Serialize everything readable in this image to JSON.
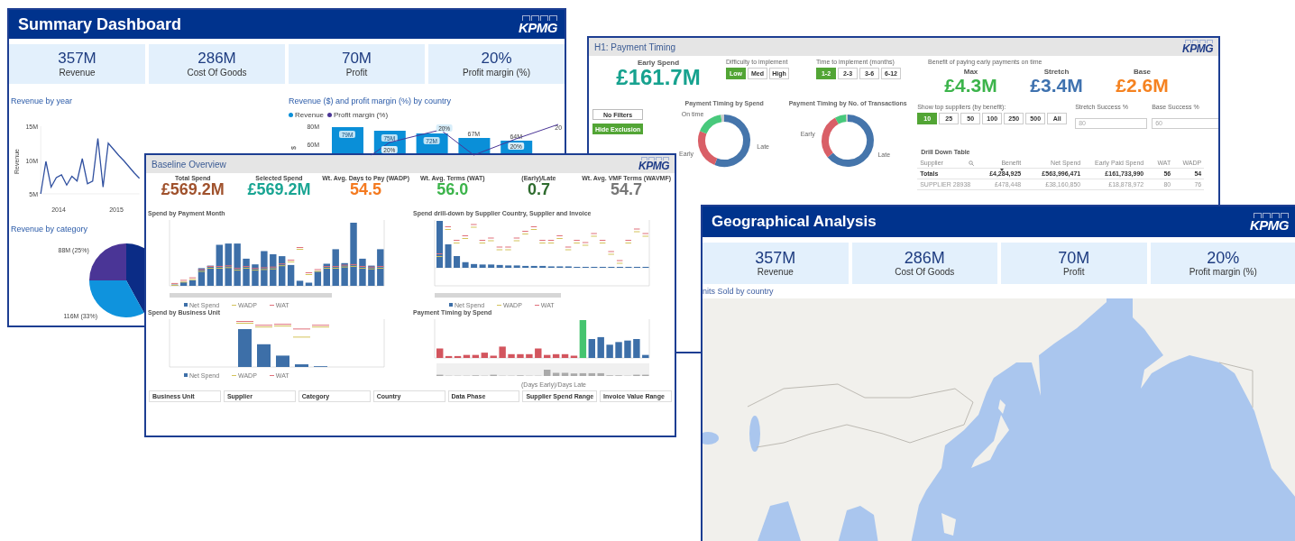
{
  "summary_dashboard": {
    "title": "Summary Dashboard",
    "logo": "KPMG",
    "kpis": [
      {
        "value": "357M",
        "label": "Revenue"
      },
      {
        "value": "286M",
        "label": "Cost Of Goods"
      },
      {
        "value": "70M",
        "label": "Profit"
      },
      {
        "value": "20%",
        "label": "Profit margin (%)"
      }
    ],
    "revenue_by_year": {
      "title": "Revenue by year",
      "chart_data": {
        "type": "line",
        "ylabel": "Revenue",
        "x": [
          2013.69,
          2013.78,
          2013.87,
          2013.96,
          2014.05,
          2014.14,
          2014.23,
          2014.32,
          2014.41,
          2014.5,
          2014.59,
          2014.68,
          2014.77,
          2014.86,
          2014.95,
          2015.04,
          2015.13,
          2015.22,
          2015.31,
          2015.4
        ],
        "xlim": [
          2013.69,
          2015.4
        ],
        "ylim": [
          5,
          15
        ],
        "xticks": [
          2014,
          2015
        ],
        "yticks": [
          {
            "value": 5,
            "label": "5M"
          },
          {
            "value": 10,
            "label": "10M"
          },
          {
            "value": 15,
            "label": "15M"
          }
        ],
        "series": [
          {
            "color": "#2f4f9f",
            "values": [
              5,
              9.8,
              6,
              7.4,
              7.8,
              6.3,
              7.6,
              6.9,
              10.2,
              6.5,
              6.9,
              13.2,
              6,
              12.5,
              11.6,
              10.7,
              9.9,
              9,
              8.1,
              7.3
            ]
          }
        ]
      }
    },
    "revenue_by_country": {
      "title": "Revenue ($) and profit margin (%) by country",
      "chart_data": {
        "type": "bar",
        "ylabel": "$",
        "categories": [
          null,
          null,
          null,
          null,
          null
        ],
        "ylim": [
          48,
          80
        ],
        "yticks": [
          {
            "value": 60,
            "label": "60M"
          },
          {
            "value": 80,
            "label": "80M"
          }
        ],
        "series": [
          {
            "name": "Revenue",
            "color": "#0a8fd8",
            "values": [
              79,
              75,
              72,
              67,
              64
            ],
            "value_labels": [
              "79M",
              "75M",
              "72M",
              "67M",
              "64M"
            ]
          }
        ]
      },
      "profit_margin": {
        "name": "Profit margin (%)",
        "color": "#4a3596",
        "labels": [
          "20%",
          "20%",
          "20%",
          "20"
        ]
      }
    },
    "revenue_by_category": {
      "title": "Revenue by category",
      "chart_data": {
        "type": "pie",
        "values": [
          42,
          33,
          25
        ],
        "value_labels": [
          null,
          "116M (33%)",
          "88M (25%)"
        ]
      }
    }
  },
  "payment_timing": {
    "title": "H1: Payment Timing",
    "logo": "KPMG",
    "early_spend": {
      "label": "Early Spend",
      "value": "£161.7M"
    },
    "difficulty": {
      "label": "Difficulty to implement",
      "options": [
        {
          "label": "Low",
          "selected": true
        },
        {
          "label": "Med",
          "selected": false
        },
        {
          "label": "High",
          "selected": false
        }
      ]
    },
    "time_to_implement": {
      "label": "Time to implement (months)",
      "options": [
        {
          "label": "1-2",
          "selected": true
        },
        {
          "label": "2-3",
          "selected": false
        },
        {
          "label": "3-6",
          "selected": false
        },
        {
          "label": "6-12",
          "selected": false
        }
      ]
    },
    "benefit": {
      "label": "Benefit of paying early payments on time",
      "kpis": [
        {
          "label": "Max",
          "value": "£4.3M",
          "color": "#3cb44b"
        },
        {
          "label": "Stretch",
          "value": "£3.4M",
          "color": "#3f72af"
        },
        {
          "label": "Base",
          "value": "£2.6M",
          "color": "#f58220"
        }
      ]
    },
    "filter_buttons": [
      {
        "label": "No Filters",
        "kind": "outline"
      },
      {
        "label": "Hide Exclusion",
        "kind": "primary"
      }
    ],
    "donuts": [
      {
        "title": "Payment Timing by Spend",
        "segments": [
          {
            "label": "Late",
            "color": "#4575ab"
          },
          {
            "label": "Early",
            "color": "#d95f67"
          },
          {
            "label": "On time",
            "color": "#48c97c"
          }
        ]
      },
      {
        "title": "Payment Timing by No. of Transactions",
        "segments": [
          {
            "label": "Late",
            "color": "#4575ab"
          },
          {
            "label": "Early",
            "color": "#d95f67"
          },
          {
            "color": "#48c97c"
          }
        ]
      }
    ],
    "top_suppliers": {
      "label": "Show top suppliers (by benefit):",
      "options": [
        {
          "label": "10",
          "selected": true
        },
        {
          "label": "25",
          "selected": false
        },
        {
          "label": "50",
          "selected": false
        },
        {
          "label": "100",
          "selected": false
        },
        {
          "label": "250",
          "selected": false
        },
        {
          "label": "500",
          "selected": false
        },
        {
          "label": "All",
          "selected": false
        }
      ]
    },
    "success_fields": [
      {
        "label": "Stretch Success %",
        "placeholder": "80"
      },
      {
        "label": "Base Success %",
        "placeholder": "60"
      }
    ],
    "drill_down_table": {
      "title": "Drill Down Table",
      "columns": [
        {
          "label": "Supplier",
          "searchable": true,
          "sorted": false
        },
        {
          "label": "Benefit",
          "searchable": false,
          "sorted": true
        },
        {
          "label": "Net Spend",
          "searchable": false,
          "sorted": false
        },
        {
          "label": "Early Paid Spend",
          "searchable": false,
          "sorted": false
        },
        {
          "label": "WAT",
          "searchable": false,
          "sorted": false
        },
        {
          "label": "WADP",
          "searchable": false,
          "sorted": false
        }
      ],
      "rows": [
        {
          "kind": "totals",
          "cells": [
            "Totals",
            "£4,284,925",
            "£563,996,471",
            "£161,733,990",
            "56",
            "54"
          ]
        },
        {
          "kind": "data",
          "cells": [
            "SUPPLIER 28938",
            "£478,448",
            "£38,160,850",
            "£18,878,972",
            "80",
            "76"
          ]
        }
      ]
    }
  },
  "baseline_overview": {
    "title": "Baseline Overview",
    "logo": "KPMG",
    "kpis": [
      {
        "label": "Total Spend",
        "value": "£569.2M",
        "color": "#a0522d"
      },
      {
        "label": "Selected Spend",
        "value": "£569.2M",
        "color": "#1aa593"
      },
      {
        "label": "Wt. Avg. Days to Pay (WADP)",
        "value": "54.5",
        "color": "#f47a20"
      },
      {
        "label": "Wt. Avg. Terms (WAT)",
        "value": "56.0",
        "color": "#3cb44b"
      },
      {
        "label": "(Early)/Late",
        "value": "0.7",
        "color": "#2e6b2e"
      },
      {
        "label": "Wt. Avg. VMF Terms (WAVMF)",
        "value": "54.7",
        "color": "#777777"
      }
    ],
    "charts": [
      {
        "title": "Spend by Payment Month",
        "kind": "month",
        "legend": [
          {
            "label": "Net Spend",
            "kind": "bar",
            "color": "#3d6fa8"
          },
          {
            "label": "WADP",
            "kind": "dash",
            "color": "#d4c35a"
          },
          {
            "label": "WAT",
            "kind": "dash",
            "color": "#e0707a"
          }
        ]
      },
      {
        "title": "Spend drill-down by Supplier Country, Supplier and Invoice",
        "kind": "supplier",
        "legend": [
          {
            "label": "Net Spend",
            "kind": "bar",
            "color": "#3d6fa8"
          },
          {
            "label": "WADP",
            "kind": "dash",
            "color": "#d4c35a"
          },
          {
            "label": "WAT",
            "kind": "dash",
            "color": "#e0707a"
          }
        ]
      },
      {
        "title": "Spend by Business Unit",
        "kind": "business_unit",
        "legend": [
          {
            "label": "Net Spend",
            "kind": "bar",
            "color": "#3d6fa8"
          },
          {
            "label": "WADP",
            "kind": "dash",
            "color": "#d4c35a"
          },
          {
            "label": "WAT",
            "kind": "dash",
            "color": "#e0707a"
          }
        ]
      },
      {
        "title": "Payment Timing by Spend",
        "kind": "timing",
        "xlabel": "(Days Early)/Days Late"
      }
    ],
    "filters": [
      "Business Unit",
      "Supplier",
      "Category",
      "Country",
      "Data Phase",
      "Supplier Spend Range",
      "Invoice Value Range"
    ]
  },
  "geographical_analysis": {
    "title": "Geographical Analysis",
    "logo": "KPMG",
    "kpis": [
      {
        "value": "357M",
        "label": "Revenue"
      },
      {
        "value": "286M",
        "label": "Cost Of Goods"
      },
      {
        "value": "70M",
        "label": "Profit"
      },
      {
        "value": "20%",
        "label": "Profit margin (%)"
      }
    ],
    "map": {
      "title": "nits Sold by country",
      "kind": "picture"
    }
  }
}
